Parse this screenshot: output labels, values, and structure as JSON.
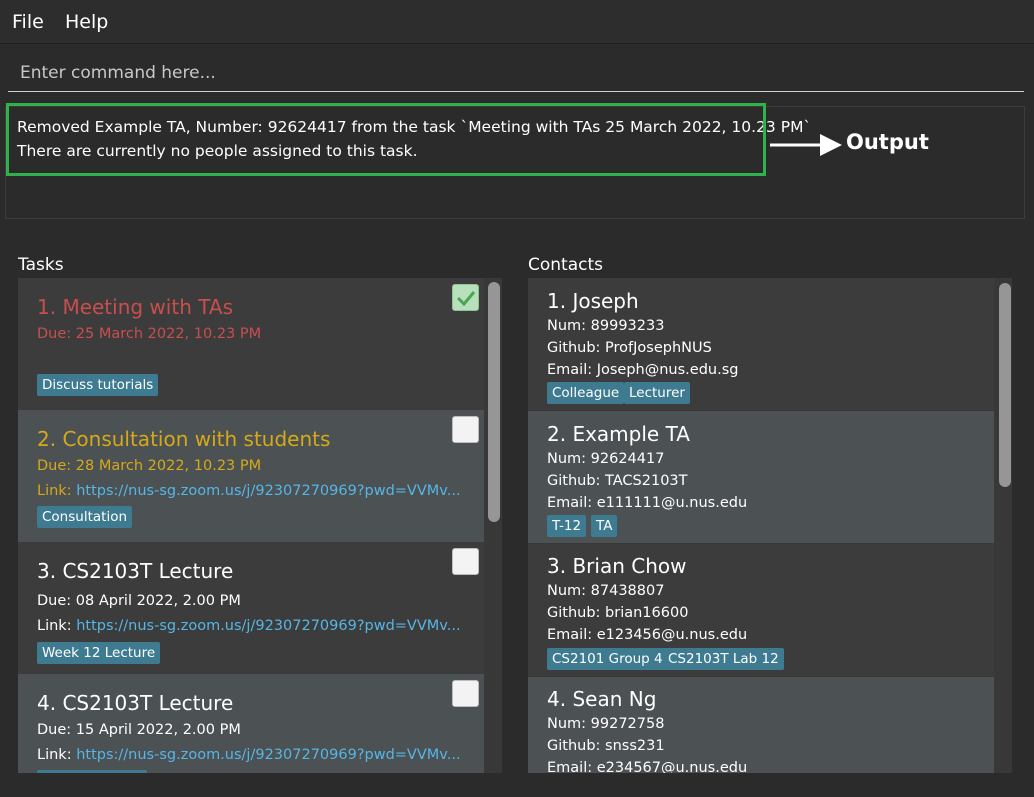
{
  "menu": {
    "file": "File",
    "help": "Help"
  },
  "command": {
    "placeholder": "Enter command here..."
  },
  "result": {
    "line1": "Removed Example TA, Number: 92624417 from the task `Meeting with TAs 25 March 2022, 10.23 PM`",
    "line2": "There are currently no people assigned to this task."
  },
  "annotation": {
    "label": "Output"
  },
  "tasks": {
    "title": "Tasks",
    "items": [
      {
        "title": "1.  Meeting with TAs",
        "due": "Due: 25 March 2022, 10.23 PM",
        "link_label": "",
        "link": "",
        "tags": [
          "Discuss tutorials"
        ],
        "checked": true,
        "status_color": "#c94e4e"
      },
      {
        "title": "2.  Consultation with students",
        "due": "Due: 28 March 2022, 10.23 PM",
        "link_label": "Link:",
        "link": "https://nus-sg.zoom.us/j/92307270969?pwd=VVMv...",
        "tags": [
          "Consultation"
        ],
        "checked": false,
        "status_color": "#d6a91a"
      },
      {
        "title": "3.  CS2103T Lecture",
        "due": "Due: 08 April 2022, 2.00 PM",
        "link_label": "Link:",
        "link": "https://nus-sg.zoom.us/j/92307270969?pwd=VVMv...",
        "tags": [
          "Week 12 Lecture"
        ],
        "checked": false
      },
      {
        "title": "4.  CS2103T Lecture",
        "due": "Due: 15 April 2022, 2.00 PM",
        "link_label": "Link:",
        "link": "https://nus-sg.zoom.us/j/92307270969?pwd=VVMv...",
        "tags": [
          ""
        ],
        "checked": false
      }
    ]
  },
  "contacts": {
    "title": "Contacts",
    "items": [
      {
        "name": "1.  Joseph",
        "num": "Num: 89993233",
        "github": "Github: ProfJosephNUS",
        "email": "Email: Joseph@nus.edu.sg",
        "tags": [
          "Colleague",
          "Lecturer"
        ]
      },
      {
        "name": "2.  Example TA",
        "num": "Num: 92624417",
        "github": "Github: TACS2103T",
        "email": "Email: e111111@u.nus.edu",
        "tags": [
          "T-12",
          "TA"
        ]
      },
      {
        "name": "3.  Brian Chow",
        "num": "Num: 87438807",
        "github": "Github: brian16600",
        "email": "Email: e123456@u.nus.edu",
        "tags": [
          "CS2101 Group 4",
          "CS2103T Lab 12"
        ]
      },
      {
        "name": "4.  Sean Ng",
        "num": "Num: 99272758",
        "github": "Github: snss231",
        "email": "Email: e234567@u.nus.edu",
        "tags": []
      }
    ]
  },
  "colors": {
    "accent_green": "#2fb24a",
    "tag_bg": "#3e7b91",
    "link": "#56b6e6"
  }
}
